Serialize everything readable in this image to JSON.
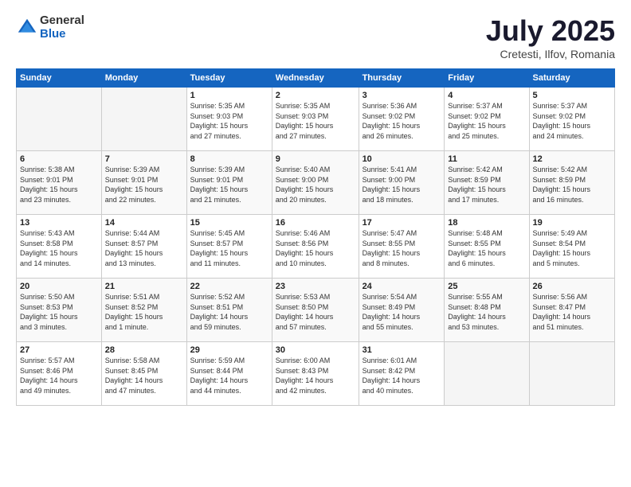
{
  "header": {
    "logo_general": "General",
    "logo_blue": "Blue",
    "month_title": "July 2025",
    "subtitle": "Cretesti, Ilfov, Romania"
  },
  "weekdays": [
    "Sunday",
    "Monday",
    "Tuesday",
    "Wednesday",
    "Thursday",
    "Friday",
    "Saturday"
  ],
  "weeks": [
    [
      {
        "day": "",
        "content": ""
      },
      {
        "day": "",
        "content": ""
      },
      {
        "day": "1",
        "content": "Sunrise: 5:35 AM\nSunset: 9:03 PM\nDaylight: 15 hours\nand 27 minutes."
      },
      {
        "day": "2",
        "content": "Sunrise: 5:35 AM\nSunset: 9:03 PM\nDaylight: 15 hours\nand 27 minutes."
      },
      {
        "day": "3",
        "content": "Sunrise: 5:36 AM\nSunset: 9:02 PM\nDaylight: 15 hours\nand 26 minutes."
      },
      {
        "day": "4",
        "content": "Sunrise: 5:37 AM\nSunset: 9:02 PM\nDaylight: 15 hours\nand 25 minutes."
      },
      {
        "day": "5",
        "content": "Sunrise: 5:37 AM\nSunset: 9:02 PM\nDaylight: 15 hours\nand 24 minutes."
      }
    ],
    [
      {
        "day": "6",
        "content": "Sunrise: 5:38 AM\nSunset: 9:01 PM\nDaylight: 15 hours\nand 23 minutes."
      },
      {
        "day": "7",
        "content": "Sunrise: 5:39 AM\nSunset: 9:01 PM\nDaylight: 15 hours\nand 22 minutes."
      },
      {
        "day": "8",
        "content": "Sunrise: 5:39 AM\nSunset: 9:01 PM\nDaylight: 15 hours\nand 21 minutes."
      },
      {
        "day": "9",
        "content": "Sunrise: 5:40 AM\nSunset: 9:00 PM\nDaylight: 15 hours\nand 20 minutes."
      },
      {
        "day": "10",
        "content": "Sunrise: 5:41 AM\nSunset: 9:00 PM\nDaylight: 15 hours\nand 18 minutes."
      },
      {
        "day": "11",
        "content": "Sunrise: 5:42 AM\nSunset: 8:59 PM\nDaylight: 15 hours\nand 17 minutes."
      },
      {
        "day": "12",
        "content": "Sunrise: 5:42 AM\nSunset: 8:59 PM\nDaylight: 15 hours\nand 16 minutes."
      }
    ],
    [
      {
        "day": "13",
        "content": "Sunrise: 5:43 AM\nSunset: 8:58 PM\nDaylight: 15 hours\nand 14 minutes."
      },
      {
        "day": "14",
        "content": "Sunrise: 5:44 AM\nSunset: 8:57 PM\nDaylight: 15 hours\nand 13 minutes."
      },
      {
        "day": "15",
        "content": "Sunrise: 5:45 AM\nSunset: 8:57 PM\nDaylight: 15 hours\nand 11 minutes."
      },
      {
        "day": "16",
        "content": "Sunrise: 5:46 AM\nSunset: 8:56 PM\nDaylight: 15 hours\nand 10 minutes."
      },
      {
        "day": "17",
        "content": "Sunrise: 5:47 AM\nSunset: 8:55 PM\nDaylight: 15 hours\nand 8 minutes."
      },
      {
        "day": "18",
        "content": "Sunrise: 5:48 AM\nSunset: 8:55 PM\nDaylight: 15 hours\nand 6 minutes."
      },
      {
        "day": "19",
        "content": "Sunrise: 5:49 AM\nSunset: 8:54 PM\nDaylight: 15 hours\nand 5 minutes."
      }
    ],
    [
      {
        "day": "20",
        "content": "Sunrise: 5:50 AM\nSunset: 8:53 PM\nDaylight: 15 hours\nand 3 minutes."
      },
      {
        "day": "21",
        "content": "Sunrise: 5:51 AM\nSunset: 8:52 PM\nDaylight: 15 hours\nand 1 minute."
      },
      {
        "day": "22",
        "content": "Sunrise: 5:52 AM\nSunset: 8:51 PM\nDaylight: 14 hours\nand 59 minutes."
      },
      {
        "day": "23",
        "content": "Sunrise: 5:53 AM\nSunset: 8:50 PM\nDaylight: 14 hours\nand 57 minutes."
      },
      {
        "day": "24",
        "content": "Sunrise: 5:54 AM\nSunset: 8:49 PM\nDaylight: 14 hours\nand 55 minutes."
      },
      {
        "day": "25",
        "content": "Sunrise: 5:55 AM\nSunset: 8:48 PM\nDaylight: 14 hours\nand 53 minutes."
      },
      {
        "day": "26",
        "content": "Sunrise: 5:56 AM\nSunset: 8:47 PM\nDaylight: 14 hours\nand 51 minutes."
      }
    ],
    [
      {
        "day": "27",
        "content": "Sunrise: 5:57 AM\nSunset: 8:46 PM\nDaylight: 14 hours\nand 49 minutes."
      },
      {
        "day": "28",
        "content": "Sunrise: 5:58 AM\nSunset: 8:45 PM\nDaylight: 14 hours\nand 47 minutes."
      },
      {
        "day": "29",
        "content": "Sunrise: 5:59 AM\nSunset: 8:44 PM\nDaylight: 14 hours\nand 44 minutes."
      },
      {
        "day": "30",
        "content": "Sunrise: 6:00 AM\nSunset: 8:43 PM\nDaylight: 14 hours\nand 42 minutes."
      },
      {
        "day": "31",
        "content": "Sunrise: 6:01 AM\nSunset: 8:42 PM\nDaylight: 14 hours\nand 40 minutes."
      },
      {
        "day": "",
        "content": ""
      },
      {
        "day": "",
        "content": ""
      }
    ]
  ]
}
